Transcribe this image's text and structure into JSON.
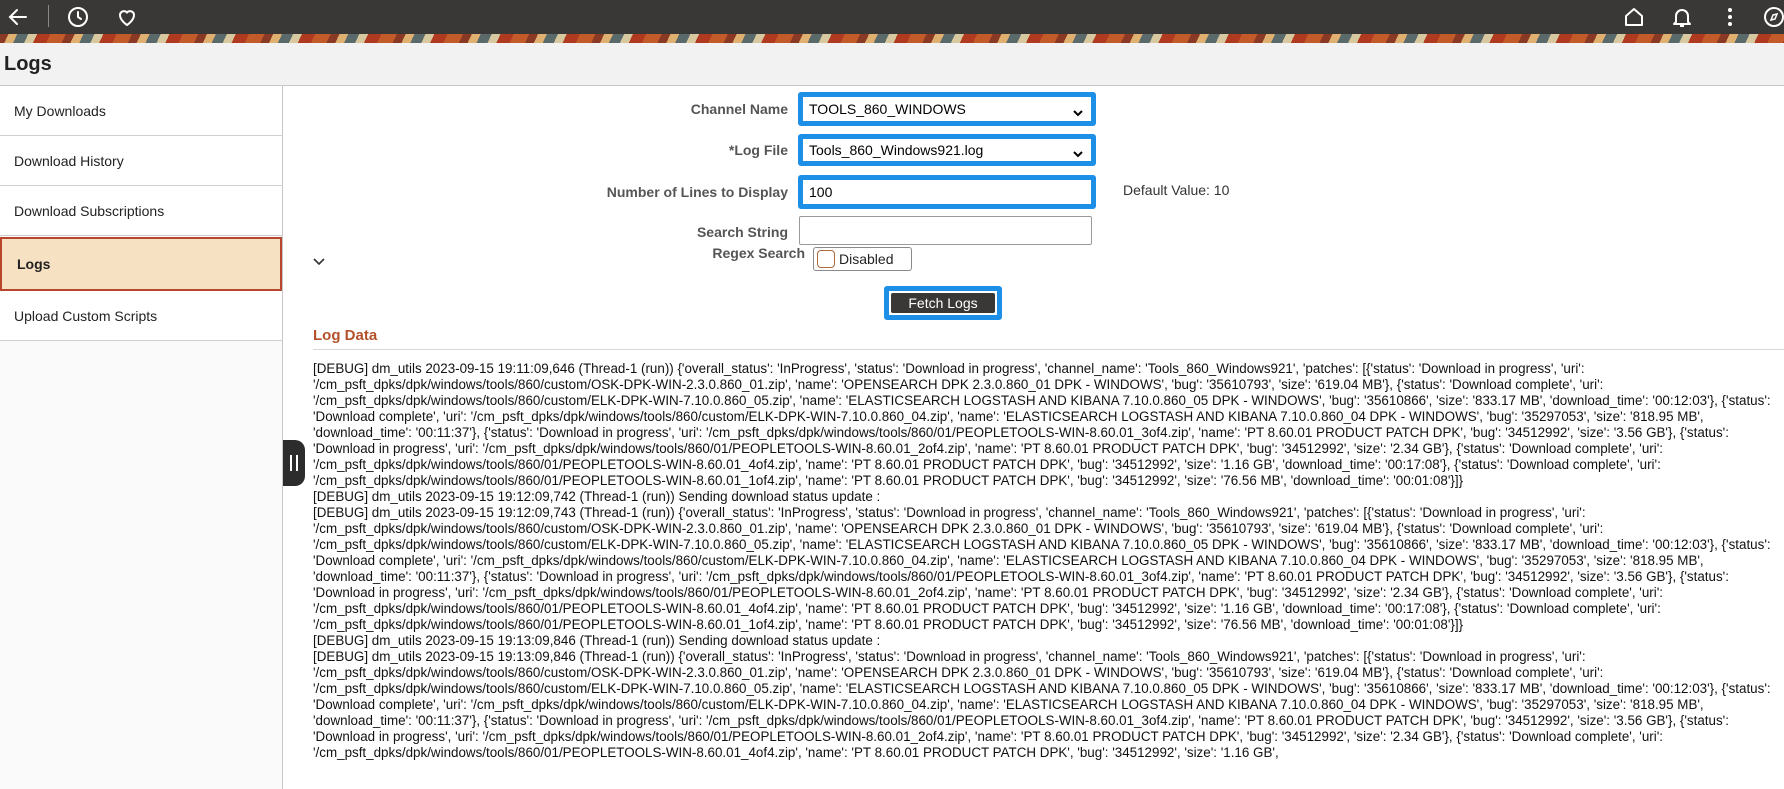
{
  "topbar": {
    "icons": [
      "back-arrow-icon",
      "history-icon",
      "heart-icon",
      "home-icon",
      "bell-icon",
      "kebab-menu-icon",
      "compass-icon"
    ]
  },
  "page": {
    "title": "Logs"
  },
  "sidebar": {
    "items": [
      {
        "label": "My Downloads"
      },
      {
        "label": "Download History"
      },
      {
        "label": "Download Subscriptions"
      },
      {
        "label": "Logs",
        "active": true
      },
      {
        "label": "Upload Custom Scripts"
      }
    ]
  },
  "form": {
    "channel_label": "Channel Name",
    "channel_value": "TOOLS_860_WINDOWS",
    "logfile_label": "*Log File",
    "logfile_value": "Tools_860_Windows921.log",
    "lines_label": "Number of Lines to Display",
    "lines_value": "100",
    "default_hint": "Default Value: 10",
    "search_label": "Search String",
    "search_value": "",
    "regex_label": "Regex Search",
    "regex_toggle_text": "Disabled",
    "fetch_label": "Fetch Logs"
  },
  "log": {
    "section_title": "Log Data",
    "lines": [
      "[DEBUG] dm_utils 2023-09-15 19:11:09,646 (Thread-1 (run)) {'overall_status': 'InProgress', 'status': 'Download in progress', 'channel_name': 'Tools_860_Windows921', 'patches': [{'status': 'Download in progress', 'uri': '/cm_psft_dpks/dpk/windows/tools/860/custom/OSK-DPK-WIN-2.3.0.860_01.zip', 'name': 'OPENSEARCH DPK 2.3.0.860_01 DPK - WINDOWS', 'bug': '35610793', 'size': '619.04 MB'}, {'status': 'Download complete', 'uri': '/cm_psft_dpks/dpk/windows/tools/860/custom/ELK-DPK-WIN-7.10.0.860_05.zip', 'name': 'ELASTICSEARCH LOGSTASH AND KIBANA 7.10.0.860_05 DPK - WINDOWS', 'bug': '35610866', 'size': '833.17 MB', 'download_time': '00:12:03'}, {'status': 'Download complete', 'uri': '/cm_psft_dpks/dpk/windows/tools/860/custom/ELK-DPK-WIN-7.10.0.860_04.zip', 'name': 'ELASTICSEARCH LOGSTASH AND KIBANA 7.10.0.860_04 DPK - WINDOWS', 'bug': '35297053', 'size': '818.95 MB', 'download_time': '00:11:37'}, {'status': 'Download in progress', 'uri': '/cm_psft_dpks/dpk/windows/tools/860/01/PEOPLETOOLS-WIN-8.60.01_3of4.zip', 'name': 'PT 8.60.01 PRODUCT PATCH DPK', 'bug': '34512992', 'size': '3.56 GB'}, {'status': 'Download in progress', 'uri': '/cm_psft_dpks/dpk/windows/tools/860/01/PEOPLETOOLS-WIN-8.60.01_2of4.zip', 'name': 'PT 8.60.01 PRODUCT PATCH DPK', 'bug': '34512992', 'size': '2.34 GB'}, {'status': 'Download complete', 'uri': '/cm_psft_dpks/dpk/windows/tools/860/01/PEOPLETOOLS-WIN-8.60.01_4of4.zip', 'name': 'PT 8.60.01 PRODUCT PATCH DPK', 'bug': '34512992', 'size': '1.16 GB', 'download_time': '00:17:08'}, {'status': 'Download complete', 'uri': '/cm_psft_dpks/dpk/windows/tools/860/01/PEOPLETOOLS-WIN-8.60.01_1of4.zip', 'name': 'PT 8.60.01 PRODUCT PATCH DPK', 'bug': '34512992', 'size': '76.56 MB', 'download_time': '00:01:08'}]}",
      "[DEBUG] dm_utils 2023-09-15 19:12:09,742 (Thread-1 (run)) Sending download status update :",
      "[DEBUG] dm_utils 2023-09-15 19:12:09,743 (Thread-1 (run)) {'overall_status': 'InProgress', 'status': 'Download in progress', 'channel_name': 'Tools_860_Windows921', 'patches': [{'status': 'Download in progress', 'uri': '/cm_psft_dpks/dpk/windows/tools/860/custom/OSK-DPK-WIN-2.3.0.860_01.zip', 'name': 'OPENSEARCH DPK 2.3.0.860_01 DPK - WINDOWS', 'bug': '35610793', 'size': '619.04 MB'}, {'status': 'Download complete', 'uri': '/cm_psft_dpks/dpk/windows/tools/860/custom/ELK-DPK-WIN-7.10.0.860_05.zip', 'name': 'ELASTICSEARCH LOGSTASH AND KIBANA 7.10.0.860_05 DPK - WINDOWS', 'bug': '35610866', 'size': '833.17 MB', 'download_time': '00:12:03'}, {'status': 'Download complete', 'uri': '/cm_psft_dpks/dpk/windows/tools/860/custom/ELK-DPK-WIN-7.10.0.860_04.zip', 'name': 'ELASTICSEARCH LOGSTASH AND KIBANA 7.10.0.860_04 DPK - WINDOWS', 'bug': '35297053', 'size': '818.95 MB', 'download_time': '00:11:37'}, {'status': 'Download in progress', 'uri': '/cm_psft_dpks/dpk/windows/tools/860/01/PEOPLETOOLS-WIN-8.60.01_3of4.zip', 'name': 'PT 8.60.01 PRODUCT PATCH DPK', 'bug': '34512992', 'size': '3.56 GB'}, {'status': 'Download in progress', 'uri': '/cm_psft_dpks/dpk/windows/tools/860/01/PEOPLETOOLS-WIN-8.60.01_2of4.zip', 'name': 'PT 8.60.01 PRODUCT PATCH DPK', 'bug': '34512992', 'size': '2.34 GB'}, {'status': 'Download complete', 'uri': '/cm_psft_dpks/dpk/windows/tools/860/01/PEOPLETOOLS-WIN-8.60.01_4of4.zip', 'name': 'PT 8.60.01 PRODUCT PATCH DPK', 'bug': '34512992', 'size': '1.16 GB', 'download_time': '00:17:08'}, {'status': 'Download complete', 'uri': '/cm_psft_dpks/dpk/windows/tools/860/01/PEOPLETOOLS-WIN-8.60.01_1of4.zip', 'name': 'PT 8.60.01 PRODUCT PATCH DPK', 'bug': '34512992', 'size': '76.56 MB', 'download_time': '00:01:08'}]}",
      "[DEBUG] dm_utils 2023-09-15 19:13:09,846 (Thread-1 (run)) Sending download status update :",
      "[DEBUG] dm_utils 2023-09-15 19:13:09,846 (Thread-1 (run)) {'overall_status': 'InProgress', 'status': 'Download in progress', 'channel_name': 'Tools_860_Windows921', 'patches': [{'status': 'Download in progress', 'uri': '/cm_psft_dpks/dpk/windows/tools/860/custom/OSK-DPK-WIN-2.3.0.860_01.zip', 'name': 'OPENSEARCH DPK 2.3.0.860_01 DPK - WINDOWS', 'bug': '35610793', 'size': '619.04 MB'}, {'status': 'Download complete', 'uri': '/cm_psft_dpks/dpk/windows/tools/860/custom/ELK-DPK-WIN-7.10.0.860_05.zip', 'name': 'ELASTICSEARCH LOGSTASH AND KIBANA 7.10.0.860_05 DPK - WINDOWS', 'bug': '35610866', 'size': '833.17 MB', 'download_time': '00:12:03'}, {'status': 'Download complete', 'uri': '/cm_psft_dpks/dpk/windows/tools/860/custom/ELK-DPK-WIN-7.10.0.860_04.zip', 'name': 'ELASTICSEARCH LOGSTASH AND KIBANA 7.10.0.860_04 DPK - WINDOWS', 'bug': '35297053', 'size': '818.95 MB', 'download_time': '00:11:37'}, {'status': 'Download in progress', 'uri': '/cm_psft_dpks/dpk/windows/tools/860/01/PEOPLETOOLS-WIN-8.60.01_3of4.zip', 'name': 'PT 8.60.01 PRODUCT PATCH DPK', 'bug': '34512992', 'size': '3.56 GB'}, {'status': 'Download in progress', 'uri': '/cm_psft_dpks/dpk/windows/tools/860/01/PEOPLETOOLS-WIN-8.60.01_2of4.zip', 'name': 'PT 8.60.01 PRODUCT PATCH DPK', 'bug': '34512992', 'size': '2.34 GB'}, {'status': 'Download complete', 'uri': '/cm_psft_dpks/dpk/windows/tools/860/01/PEOPLETOOLS-WIN-8.60.01_4of4.zip', 'name': 'PT 8.60.01 PRODUCT PATCH DPK', 'bug': '34512992', 'size': '1.16 GB',"
    ]
  }
}
